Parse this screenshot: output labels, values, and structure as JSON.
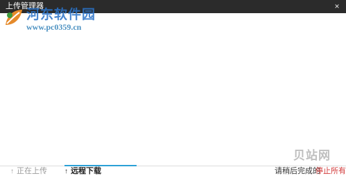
{
  "window": {
    "title": "上传管理器",
    "close_glyph": "×"
  },
  "watermark": {
    "site_name": "河东软件园",
    "url": "www.pc0359.cn",
    "logo_icon": "leaf-logo-icon"
  },
  "corner_watermark": "贝站网",
  "bottom": {
    "tabs": [
      {
        "label": "正在上传",
        "icon": "up-arrow-icon",
        "active": false
      },
      {
        "label": "远程下载",
        "icon": "up-arrow-icon",
        "active": true
      }
    ],
    "status_text": "请稍后完成的",
    "stop_label": "停止所有"
  },
  "colors": {
    "titlebar": "#2b2b2b",
    "active_tab_accent": "#2ba0d6",
    "stop_link": "#d23a3a"
  }
}
